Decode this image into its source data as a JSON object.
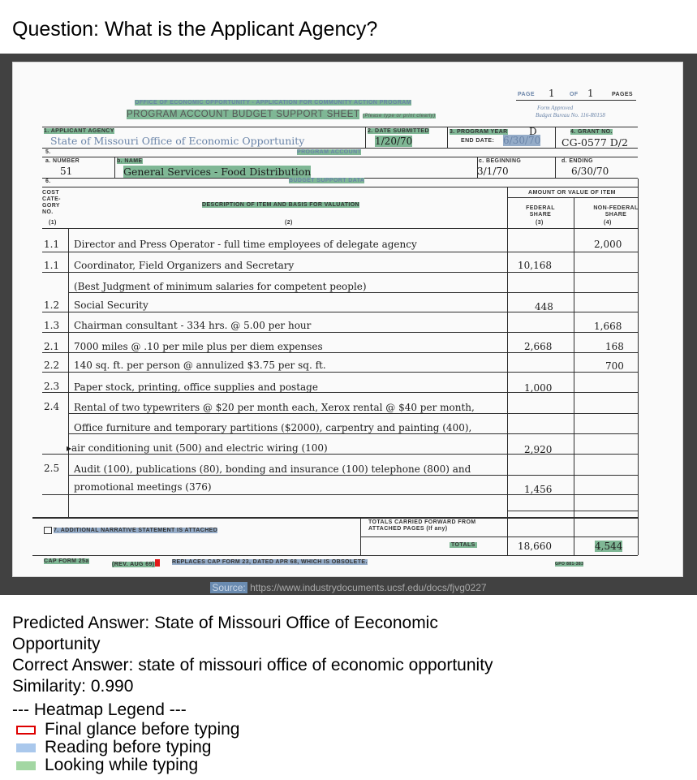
{
  "question": "Question: What is the Applicant Agency?",
  "doc": {
    "page_label": "PAGE",
    "page_num": "1",
    "of_label": "OF",
    "of_num": "1",
    "pages_label": "PAGES",
    "form_approved": "Form Approved",
    "budget_bureau": "Budget Bureau No. 116-R0158",
    "title1": "OFFICE OF ECONOMIC OPPORTUNITY - APPLICATION FOR COMMUNITY ACTION PROGRAM",
    "title2": "PROGRAM ACCOUNT BUDGET SUPPORT SHEET",
    "title2_note": "(Please type or print clearly)",
    "applicant_agency_label": "1. APPLICANT AGENCY",
    "applicant_agency": "State of Missouri Office of Economic Opportunity",
    "date_submitted_label": "2. DATE SUBMITTED",
    "date_submitted": "1/20/70",
    "program_year_label": "3. PROGRAM YEAR",
    "program_year": "D",
    "end_date_label": "END DATE:",
    "end_date": "6/30/70",
    "grant_no_label": "4. GRANT NO.",
    "grant_no": "CG-0577 D/2",
    "section5": "5.",
    "program_account_header": "PROGRAM ACCOUNT",
    "number_label": "a. NUMBER",
    "number": "51",
    "name_label": "b. NAME",
    "name": "General Services - Food Distribution",
    "beginning_label": "c. BEGINNING",
    "beginning": "3/1/70",
    "ending_label": "d. ENDING",
    "ending": "6/30/70",
    "section6": "6.",
    "budget_support_header": "BUDGET SUPPORT DATA",
    "cost_cat_label": "COST CATE- GORY NO.",
    "col1": "(1)",
    "desc_label": "DESCRIPTION OF ITEM AND BASIS FOR VALUATION",
    "col2": "(2)",
    "amount_label": "AMOUNT OR VALUE OF ITEM",
    "federal_label": "FEDERAL SHARE",
    "col3": "(3)",
    "nonfederal_label": "NON-FEDERAL SHARE",
    "col4": "(4)",
    "rows": [
      {
        "cat": "1.1",
        "desc": "Director and Press Operator - full time employees of delegate agency",
        "fed": "",
        "nonfed": "2,000"
      },
      {
        "cat": "1.1",
        "desc": "Coordinator, Field Organizers and Secretary",
        "fed": "10,168",
        "nonfed": ""
      },
      {
        "cat": "",
        "desc": "(Best Judgment of minimum salaries for competent people)",
        "fed": "",
        "nonfed": ""
      },
      {
        "cat": "1.2",
        "desc": "Social Security",
        "fed": "448",
        "nonfed": ""
      },
      {
        "cat": "1.3",
        "desc": "Chairman consultant - 334 hrs. @ 5.00 per hour",
        "fed": "",
        "nonfed": "1,668"
      },
      {
        "cat": "2.1",
        "desc": "7000 miles @ .10 per mile plus per diem expenses",
        "fed": "2,668",
        "nonfed": "168"
      },
      {
        "cat": "2.2",
        "desc": "140 sq. ft. per person @ annulized $3.75 per sq. ft.",
        "fed": "",
        "nonfed": "700"
      },
      {
        "cat": "2.3",
        "desc": "Paper stock, printing, office supplies and postage",
        "fed": "1,000",
        "nonfed": ""
      },
      {
        "cat": "2.4",
        "desc": "Rental of two typewriters @ $20 per month each, Xerox rental @ $40 per month,",
        "fed": "",
        "nonfed": ""
      },
      {
        "cat": "",
        "desc": "Office furniture and temporary partitions ($2000), carpentry and painting (400),",
        "fed": "",
        "nonfed": ""
      },
      {
        "cat": "",
        "desc": "air conditioning unit (500) and electric wiring (100)",
        "fed": "2,920",
        "nonfed": ""
      },
      {
        "cat": "2.5",
        "desc": "Audit (100), publications (80), bonding and insurance (100) telephone (800) and",
        "fed": "",
        "nonfed": ""
      },
      {
        "cat": "",
        "desc": "promotional meetings (376)",
        "fed": "1,456",
        "nonfed": ""
      }
    ],
    "additional_narrative": "7. ADDITIONAL NARRATIVE STATEMENT IS ATTACHED",
    "totals_forward": "TOTALS CARRIED FORWARD FROM ATTACHED PAGES (If any)",
    "totals_label": "TOTALS",
    "total_fed": "18,660",
    "total_nonfed": "4,544",
    "cap_form": "CAP FORM 25a",
    "rev_date": "(REV. AUG 69)",
    "replaces": "REPLACES CAP FORM 23, DATED APR 68, WHICH IS OBSOLETE.",
    "gpo": "GPO 881-383"
  },
  "source_label": "Source:",
  "source_url": "https://www.industrydocuments.ucsf.edu/docs/fjvg0227",
  "predicted": "Predicted Answer: State of Missouri Office of Eeconomic Opportunity",
  "correct": "Correct Answer: state of missouri office of economic opportunity",
  "similarity": "Similarity: 0.990",
  "legend": {
    "title": "--- Heatmap Legend ---",
    "items": [
      "Final glance before typing",
      "Reading before typing",
      "Looking while typing"
    ],
    "colors": [
      "#dd0000",
      "#aac8ec",
      "#a3d7a3"
    ]
  }
}
